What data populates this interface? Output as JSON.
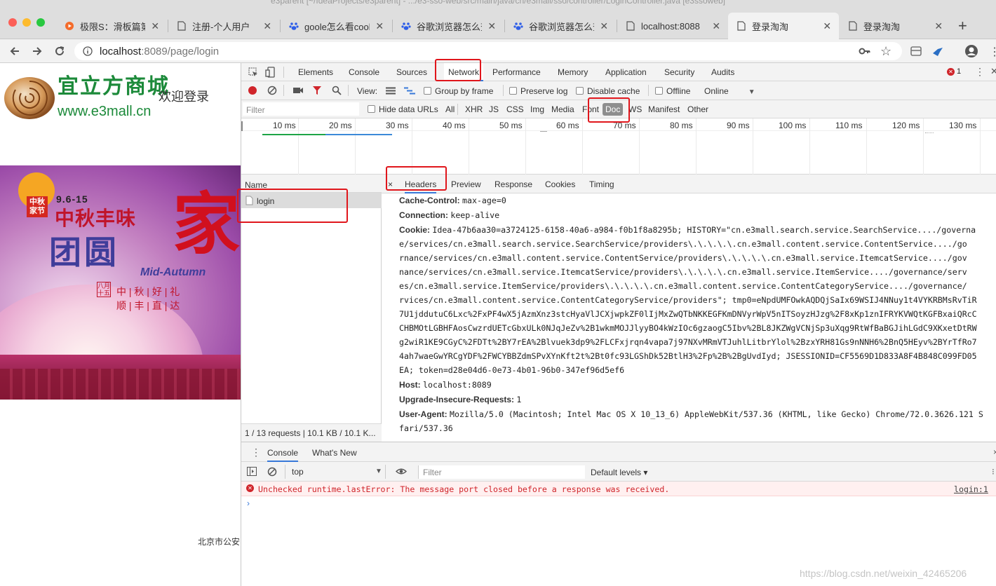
{
  "window": {
    "title": "e3parent [~/IdeaProjects/e3parent] - .../e3-sso-web/src/main/java/cn/e3mall/sso/controller/LoginController.java [e3ssoweb]"
  },
  "tabs": [
    {
      "label": "极限S：滑板篇第",
      "icon": "video-icon"
    },
    {
      "label": "注册-个人用户",
      "icon": "page-icon"
    },
    {
      "label": "goole怎么看cook",
      "icon": "baidu-paw-icon"
    },
    {
      "label": "谷歌浏览器怎么查",
      "icon": "baidu-paw-icon"
    },
    {
      "label": "谷歌浏览器怎么查",
      "icon": "baidu-paw-icon"
    },
    {
      "label": "localhost:8088",
      "icon": "page-icon"
    },
    {
      "label": "登录淘淘",
      "icon": "page-icon"
    },
    {
      "label": "登录淘淘",
      "icon": "page-icon"
    }
  ],
  "address": {
    "host": "localhost",
    "rest": ":8089/page/login"
  },
  "page": {
    "logo_text": "宜立方商城",
    "logo_url": "www.e3mall.cn",
    "welcome": "欢迎登录",
    "banner": {
      "date": "9.6-15",
      "badge": "中秋家节",
      "line1": "中秋丰味",
      "line2": "团圆",
      "big_char": "家",
      "english": "Mid-Autumn",
      "seal": "八月十五",
      "slogan_top": [
        "中",
        "秋",
        "好",
        "礼"
      ],
      "slogan_bottom": [
        "顺",
        "丰",
        "直",
        "达"
      ]
    },
    "footer": "北京市公安"
  },
  "devtools": {
    "tabs": [
      "Elements",
      "Console",
      "Sources",
      "Network",
      "Performance",
      "Memory",
      "Application",
      "Security",
      "Audits"
    ],
    "active_tab": "Network",
    "error_count": "1",
    "toolbar": {
      "view_label": "View:",
      "group_by_frame": "Group by frame",
      "preserve_log": "Preserve log",
      "disable_cache": "Disable cache",
      "offline": "Offline",
      "throttle": "Online"
    },
    "filter": {
      "placeholder": "Filter",
      "hide_data_urls": "Hide data URLs",
      "types": [
        "All",
        "XHR",
        "JS",
        "CSS",
        "Img",
        "Media",
        "Font",
        "Doc",
        "WS",
        "Manifest",
        "Other"
      ],
      "active_type": "Doc"
    },
    "timeline_ticks": [
      "10 ms",
      "20 ms",
      "30 ms",
      "40 ms",
      "50 ms",
      "60 ms",
      "70 ms",
      "80 ms",
      "90 ms",
      "100 ms",
      "110 ms",
      "120 ms",
      "130 ms"
    ],
    "requests": {
      "column_name": "Name",
      "items": [
        "login"
      ],
      "status": "1 / 13 requests | 10.1 KB / 10.1 K..."
    },
    "detail_tabs": [
      "Headers",
      "Preview",
      "Response",
      "Cookies",
      "Timing"
    ],
    "active_detail_tab": "Headers",
    "headers": [
      {
        "name": "Cache-Control:",
        "value": "max-age=0"
      },
      {
        "name": "Connection:",
        "value": "keep-alive"
      },
      {
        "name": "Cookie:",
        "value": "Idea-47b6aa30=a3724125-6158-40a6-a984-f0b1f8a8295b; HISTORY=\"cn.e3mall.search.service.SearchService..../governa"
      },
      {
        "name": "",
        "value": "e/services/cn.e3mall.search.service.SearchService/providers\\.\\.\\.\\.\\.cn.e3mall.content.service.ContentService..../go"
      },
      {
        "name": "",
        "value": "rnance/services/cn.e3mall.content.service.ContentService/providers\\.\\.\\.\\.\\.cn.e3mall.service.ItemcatService..../gov"
      },
      {
        "name": "",
        "value": "nance/services/cn.e3mall.service.ItemcatService/providers\\.\\.\\.\\.\\.cn.e3mall.service.ItemService..../governance/serv"
      },
      {
        "name": "",
        "value": "es/cn.e3mall.service.ItemService/providers\\.\\.\\.\\.\\.cn.e3mall.content.service.ContentCategoryService..../governance/"
      },
      {
        "name": "",
        "value": "rvices/cn.e3mall.content.service.ContentCategoryService/providers\"; tmp0=eNpdUMFOwkAQDQjSaIx69WSIJ4NNuy1t4VYKRBMsRvTiR"
      },
      {
        "name": "",
        "value": "7U1jddutuC6Lxc%2FxPF4wX5jAzmXnz3stcHyaVlJCXjwpkZF0lIjMxZwQTbNKKEGFKmDNVyrWpV5nITSoyzHJzg%2F8xKp1znIFRYKVWQtKGFBxaiQRcC"
      },
      {
        "name": "",
        "value": "CHBMOtLGBHFAosCwzrdUETcGbxULk0NJqJeZv%2B1wkmMOJJlyyBO4kWzIOc6gzaogC5Ibv%2BL8JKZWgVCNjSp3uXqg9RtWfBaBGJihLGdC9XKxetDtRW"
      },
      {
        "name": "",
        "value": "g2wiR1KE9CGyC%2FDTt%2BY7rEA%2Blvuek3dp9%2FLCFxjrqn4vapa7j97NXvMRmVTJuhlLitbrYlol%2BzxYRH81Gs9nNNH6%2BnQ5HEyv%2BYrTfRo7"
      },
      {
        "name": "",
        "value": "4ah7waeGwYRCgYDF%2FWCYBBZdmSPvXYnKft2t%2Bt0fc93LGShDk52BtlH3%2Fp%2B%2BgUvdIyd; JSESSIONID=CF5569D1D833A8F4B848C099FD05"
      },
      {
        "name": "",
        "value": "EA; token=d28e04d6-0e73-4b01-96b0-347ef96d5ef6"
      },
      {
        "name": "Host:",
        "value": "localhost:8089"
      },
      {
        "name": "Upgrade-Insecure-Requests:",
        "value": "1"
      },
      {
        "name": "User-Agent:",
        "value": "Mozilla/5.0 (Macintosh; Intel Mac OS X 10_13_6) AppleWebKit/537.36 (KHTML, like Gecko) Chrome/72.0.3626.121 S"
      },
      {
        "name": "",
        "value": "fari/537.36"
      }
    ],
    "drawer": {
      "tabs": [
        "Console",
        "What's New"
      ],
      "context": "top",
      "filter_placeholder": "Filter",
      "levels": "Default levels ▾",
      "error_message": "Unchecked runtime.lastError: The message port closed before a response was received.",
      "error_source": "login:1"
    }
  },
  "watermark": "https://blog.csdn.net/weixin_42465206",
  "colors": {
    "highlight_box": "#e0161c",
    "error": "#d0252b",
    "active_tab_underline": "#3879d9"
  }
}
